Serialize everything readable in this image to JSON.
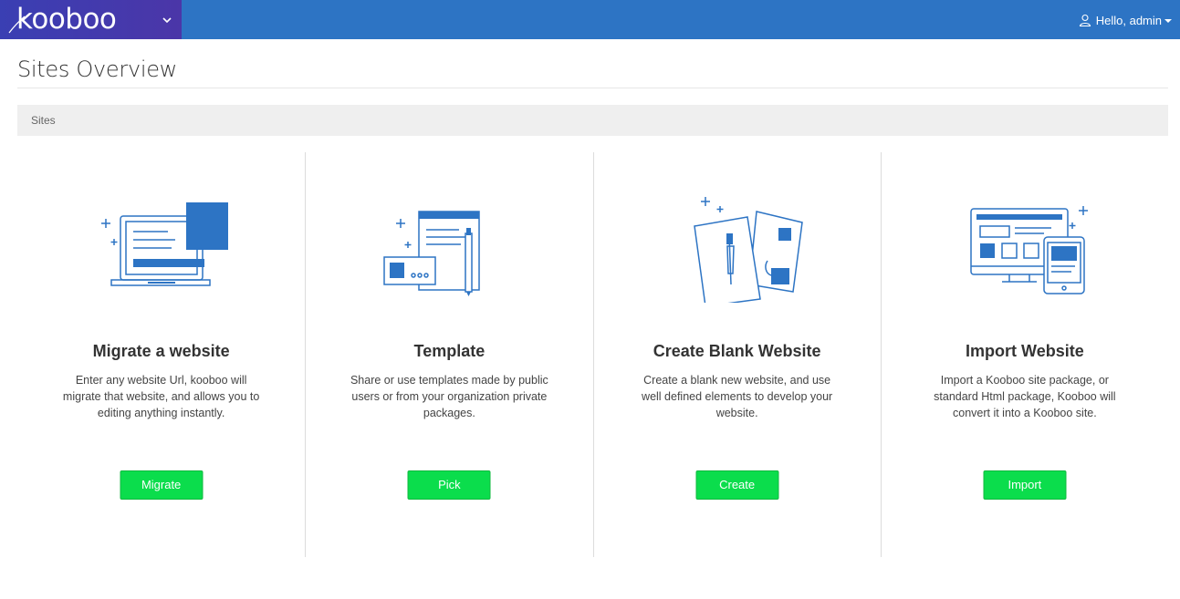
{
  "header": {
    "logo_text": "kooboo",
    "user_greeting": "Hello, admin",
    "icons": {
      "menu_toggle": "chevron-down-icon",
      "user": "user-icon",
      "dropdown": "caret-down-icon"
    },
    "colors": {
      "topbar": "#2d74c4",
      "brand": "#3e3ab0"
    }
  },
  "page": {
    "title": "Sites Overview",
    "breadcrumb": "Sites"
  },
  "cards": [
    {
      "title": "Migrate a website",
      "description": "Enter any website Url, kooboo will migrate that website, and allows you to editing anything instantly.",
      "button": "Migrate",
      "icon": "laptop-migrate-illustration"
    },
    {
      "title": "Template",
      "description": "Share or use templates made by public users or from your organization private packages.",
      "button": "Pick",
      "icon": "template-documents-illustration"
    },
    {
      "title": "Create Blank Website",
      "description": "Create a blank new website, and use well defined elements to develop your website.",
      "button": "Create",
      "icon": "blank-canvas-brush-illustration"
    },
    {
      "title": "Import Website",
      "description": "Import a Kooboo site package, or standard Html package, Kooboo will convert it into a Kooboo site.",
      "button": "Import",
      "icon": "devices-import-illustration"
    }
  ],
  "theme": {
    "accent": "#2d74c4",
    "button": "#0bdd4c"
  }
}
